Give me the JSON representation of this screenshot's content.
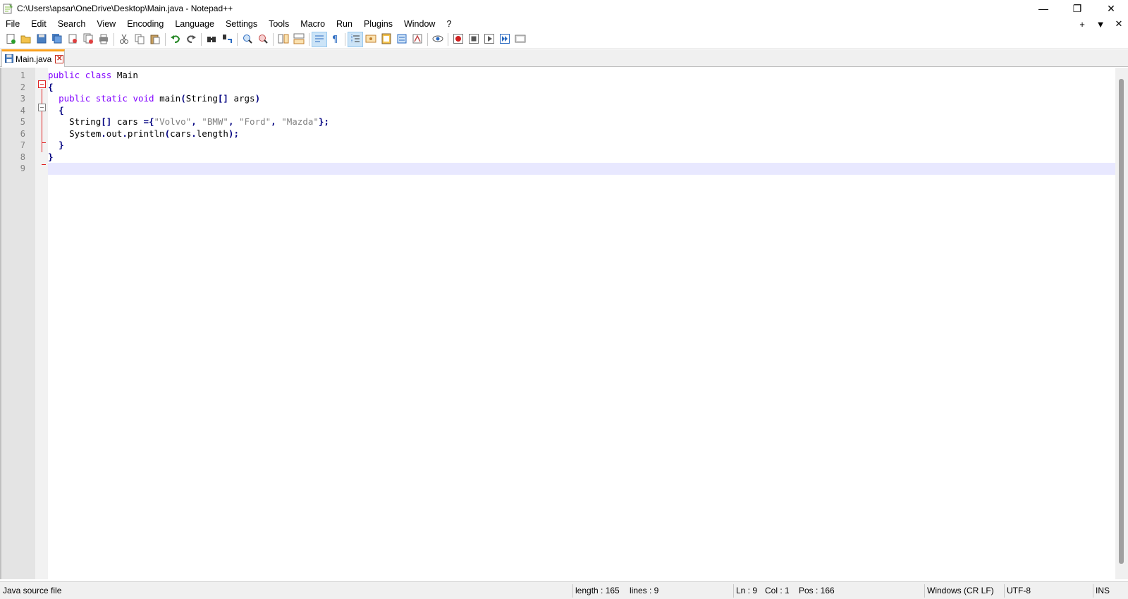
{
  "window": {
    "title": "C:\\Users\\apsar\\OneDrive\\Desktop\\Main.java - Notepad++",
    "controls": {
      "minimize": "—",
      "restore": "❐",
      "close": "✕"
    }
  },
  "menu": {
    "items": [
      "File",
      "Edit",
      "Search",
      "View",
      "Encoding",
      "Language",
      "Settings",
      "Tools",
      "Macro",
      "Run",
      "Plugins",
      "Window",
      "?"
    ],
    "right": {
      "add": "+",
      "list": "▼",
      "close": "✕"
    }
  },
  "tabs": [
    {
      "label": "Main.java",
      "active": true,
      "close": "✕"
    }
  ],
  "editor": {
    "lines": [
      [
        {
          "t": "public",
          "c": "kw"
        },
        {
          "t": " ",
          "c": "plain"
        },
        {
          "t": "class",
          "c": "kw"
        },
        {
          "t": " Main",
          "c": "plain"
        }
      ],
      [
        {
          "t": "{",
          "c": "op"
        }
      ],
      [
        {
          "t": "  ",
          "c": "plain"
        },
        {
          "t": "public",
          "c": "kw"
        },
        {
          "t": " ",
          "c": "plain"
        },
        {
          "t": "static",
          "c": "kw"
        },
        {
          "t": " ",
          "c": "plain"
        },
        {
          "t": "void",
          "c": "typ"
        },
        {
          "t": " main",
          "c": "plain"
        },
        {
          "t": "(",
          "c": "op"
        },
        {
          "t": "String",
          "c": "plain"
        },
        {
          "t": "[]",
          "c": "op"
        },
        {
          "t": " args",
          "c": "plain"
        },
        {
          "t": ")",
          "c": "op"
        }
      ],
      [
        {
          "t": "  ",
          "c": "plain"
        },
        {
          "t": "{",
          "c": "op"
        }
      ],
      [
        {
          "t": "    String",
          "c": "plain"
        },
        {
          "t": "[]",
          "c": "op"
        },
        {
          "t": " cars ",
          "c": "plain"
        },
        {
          "t": "={",
          "c": "op"
        },
        {
          "t": "\"Volvo\"",
          "c": "str"
        },
        {
          "t": ", ",
          "c": "op"
        },
        {
          "t": "\"BMW\"",
          "c": "str"
        },
        {
          "t": ", ",
          "c": "op"
        },
        {
          "t": "\"Ford\"",
          "c": "str"
        },
        {
          "t": ", ",
          "c": "op"
        },
        {
          "t": "\"Mazda\"",
          "c": "str"
        },
        {
          "t": "};",
          "c": "op"
        }
      ],
      [
        {
          "t": "    System",
          "c": "plain"
        },
        {
          "t": ".",
          "c": "op"
        },
        {
          "t": "out",
          "c": "plain"
        },
        {
          "t": ".",
          "c": "op"
        },
        {
          "t": "println",
          "c": "plain"
        },
        {
          "t": "(",
          "c": "op"
        },
        {
          "t": "cars",
          "c": "plain"
        },
        {
          "t": ".",
          "c": "op"
        },
        {
          "t": "length",
          "c": "plain"
        },
        {
          "t": ");",
          "c": "op"
        }
      ],
      [
        {
          "t": "  ",
          "c": "plain"
        },
        {
          "t": "}",
          "c": "op"
        }
      ],
      [
        {
          "t": "}",
          "c": "op"
        }
      ],
      []
    ],
    "line_numbers": [
      "1",
      "2",
      "3",
      "4",
      "5",
      "6",
      "7",
      "8",
      "9"
    ],
    "current_line_index": 8
  },
  "status": {
    "file_type": "Java source file",
    "length": "length : 165",
    "lines": "lines : 9",
    "ln": "Ln : 9",
    "col": "Col : 1",
    "pos": "Pos : 166",
    "eol": "Windows (CR LF)",
    "encoding": "UTF-8",
    "mode": "INS"
  },
  "toolbar": {
    "icons": [
      "new-file-icon",
      "open-file-icon",
      "save-icon",
      "save-all-icon",
      "close-icon",
      "close-all-icon",
      "print-icon",
      "|",
      "cut-icon",
      "copy-icon",
      "paste-icon",
      "|",
      "undo-icon",
      "redo-icon",
      "|",
      "find-icon",
      "replace-icon",
      "|",
      "zoom-in-icon",
      "zoom-out-icon",
      "|",
      "sync-vertical-icon",
      "sync-horizontal-icon",
      "|",
      "word-wrap-icon",
      "show-all-chars-icon",
      "|",
      "indent-guide-icon",
      "user-defined-language-icon",
      "document-map-icon",
      "function-list-icon",
      "folder-as-workspace-icon",
      "|",
      "monitoring-icon",
      "|",
      "record-macro-icon",
      "stop-recording-icon",
      "play-macro-icon",
      "run-macro-multiple-icon",
      "save-macro-icon"
    ],
    "pressed": [
      "word-wrap-icon",
      "indent-guide-icon"
    ]
  }
}
